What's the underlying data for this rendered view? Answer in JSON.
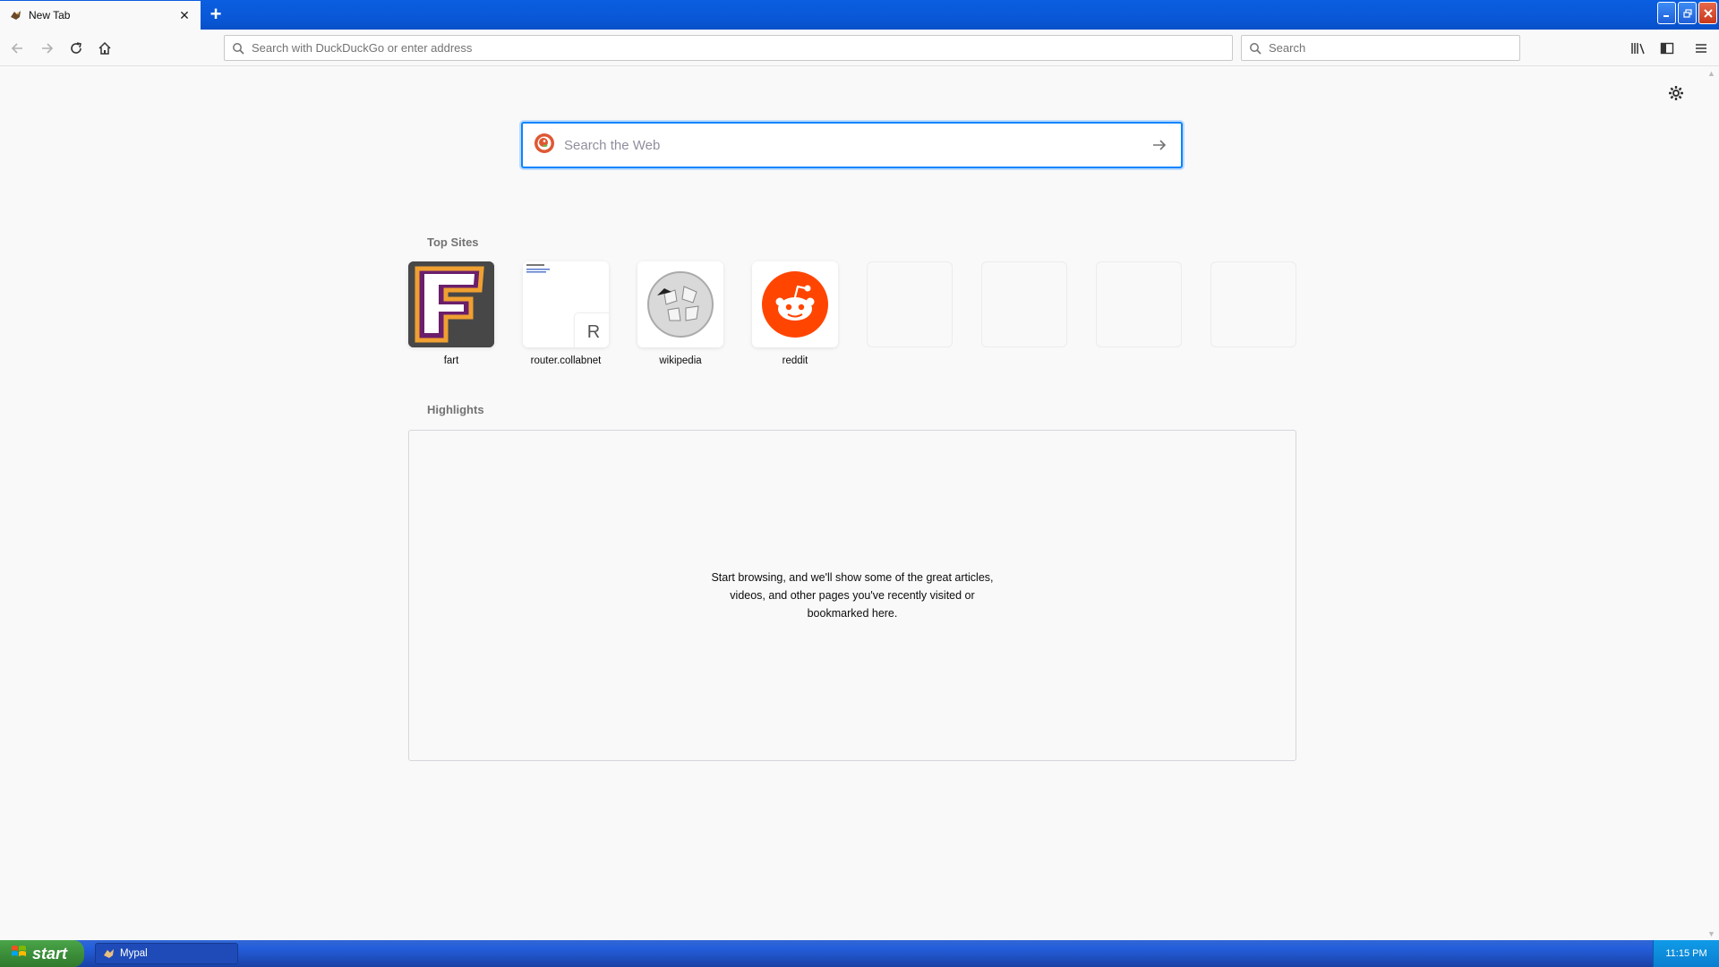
{
  "browser": {
    "tab": {
      "title": "New Tab",
      "favicon": "mypal-icon"
    },
    "urlbar": {
      "placeholder": "Search with DuckDuckGo or enter address",
      "value": ""
    },
    "searchbar": {
      "placeholder": "Search",
      "value": ""
    }
  },
  "newtab": {
    "websearch": {
      "placeholder": "Search the Web",
      "value": ""
    },
    "top_sites_title": "Top Sites",
    "top_sites": [
      {
        "label": "fart",
        "icon": "fart-logo"
      },
      {
        "label": "router.collabnet",
        "icon": "letter-r",
        "letter": "R"
      },
      {
        "label": "wikipedia",
        "icon": "wikipedia-globe"
      },
      {
        "label": "reddit",
        "icon": "reddit-alien"
      }
    ],
    "empty_tiles": 4,
    "highlights_title": "Highlights",
    "highlights_message": "Start browsing, and we'll show some of the great articles, videos, and other pages you've recently visited or bookmarked here."
  },
  "taskbar": {
    "start_label": "start",
    "items": [
      {
        "label": "Mypal"
      }
    ],
    "clock": "11:15 PM"
  },
  "colors": {
    "accent": "#0a84ff",
    "reddit": "#ff4500",
    "titlebar": "#0a5ee0",
    "start_green": "#3c8f3a"
  }
}
